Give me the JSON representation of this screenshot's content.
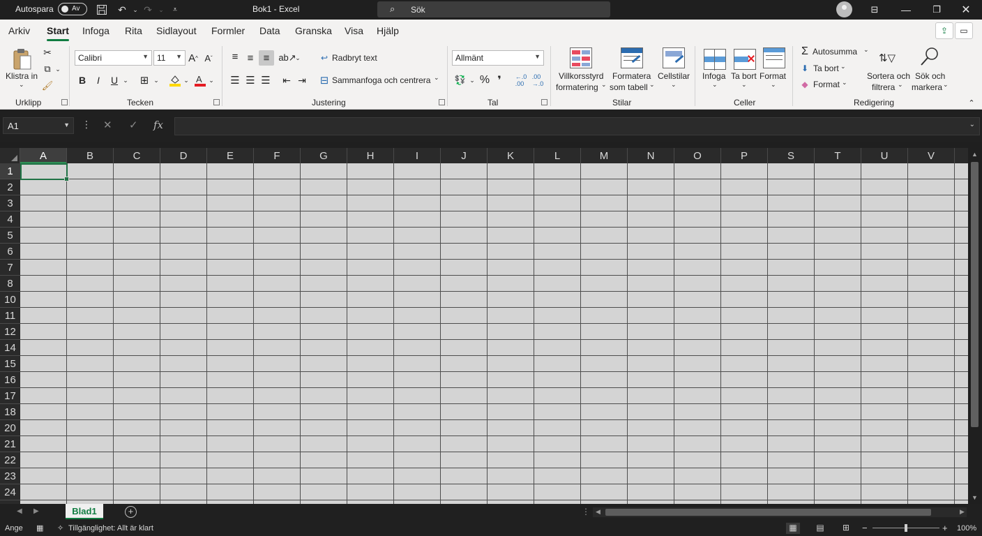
{
  "titlebar": {
    "autosave_label": "Autospara",
    "autosave_state": "Av",
    "doc_title": "Bok1  -  Excel",
    "search_placeholder": "Sök"
  },
  "tabs": [
    "Arkiv",
    "Start",
    "Infoga",
    "Rita",
    "Sidlayout",
    "Formler",
    "Data",
    "Granska",
    "Visa",
    "Hjälp"
  ],
  "active_tab": "Start",
  "ribbon": {
    "clipboard": {
      "paste": "Klistra in",
      "group": "Urklipp"
    },
    "font": {
      "name": "Calibri",
      "size": "11",
      "group": "Tecken",
      "bold": "B",
      "italic": "I",
      "underline": "U"
    },
    "alignment": {
      "wrap": "Radbryt text",
      "merge": "Sammanfoga och centrera",
      "group": "Justering"
    },
    "number": {
      "format": "Allmänt",
      "percent": "%",
      "comma": "❜",
      "group": "Tal"
    },
    "styles": {
      "cond_format_1": "Villkorsstyrd",
      "cond_format_2": "formatering",
      "format_table_1": "Formatera",
      "format_table_2": "som tabell",
      "cell_styles": "Cellstilar",
      "group": "Stilar"
    },
    "cells": {
      "insert": "Infoga",
      "delete": "Ta bort",
      "format": "Format",
      "group": "Celler"
    },
    "editing": {
      "autosum": "Autosumma",
      "fill": "Ta bort",
      "clear": "Format",
      "sort_1": "Sortera och",
      "sort_2": "filtrera",
      "find_1": "Sök och",
      "find_2": "markera",
      "group": "Redigering"
    }
  },
  "formula_bar": {
    "name_box": "A1",
    "fx": "fx",
    "formula": ""
  },
  "grid": {
    "columns": [
      "A",
      "B",
      "C",
      "D",
      "E",
      "F",
      "G",
      "H",
      "I",
      "J",
      "K",
      "L",
      "M",
      "N",
      "O",
      "P",
      "S",
      "T",
      "U",
      "V"
    ],
    "rows": [
      "1",
      "2",
      "3",
      "4",
      "5",
      "6",
      "7",
      "8",
      "10",
      "11",
      "12",
      "14",
      "15",
      "16",
      "17",
      "18",
      "20",
      "21",
      "22",
      "23",
      "24"
    ],
    "selected_cell": "A1"
  },
  "sheets": {
    "tabs": [
      "Blad1"
    ],
    "active": "Blad1"
  },
  "status": {
    "mode": "Ange",
    "accessibility": "Tillgänglighet: Allt är klart",
    "zoom": "100%",
    "zoom_fraction": 0.5
  },
  "colors": {
    "accent": "#107c41",
    "selection": "#217346"
  }
}
